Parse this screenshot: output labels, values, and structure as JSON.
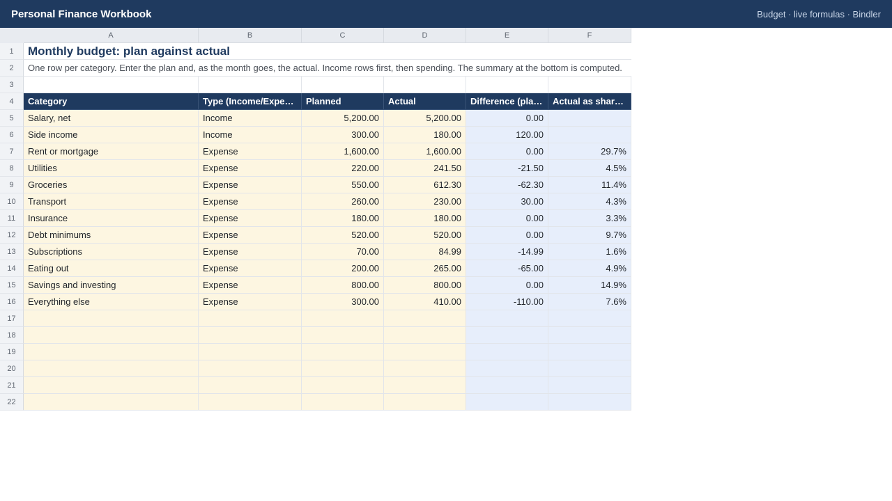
{
  "app": {
    "title": "Personal Finance Workbook",
    "meta": "Budget · live formulas · Bindler"
  },
  "colors": {
    "header_bar": "#1f3a5f",
    "input_cell": "#fdf6e1",
    "computed_cell": "#e7eefb"
  },
  "sheet": {
    "columns": [
      "A",
      "B",
      "C",
      "D",
      "E",
      "F"
    ],
    "title": "Monthly budget: plan against actual",
    "description": "One row per category. Enter the plan and, as the month goes, the actual. Income rows first, then spending. The summary at the bottom is computed.",
    "headers": [
      "Category",
      "Type (Income/Expen…",
      "Planned",
      "Actual",
      "Difference (plan…",
      "Actual as share…"
    ],
    "rows": [
      [
        "Salary, net",
        "Income",
        "5,200.00",
        "5,200.00",
        "0.00",
        ""
      ],
      [
        "Side income",
        "Income",
        "300.00",
        "180.00",
        "120.00",
        ""
      ],
      [
        "Rent or mortgage",
        "Expense",
        "1,600.00",
        "1,600.00",
        "0.00",
        "29.7%"
      ],
      [
        "Utilities",
        "Expense",
        "220.00",
        "241.50",
        "-21.50",
        "4.5%"
      ],
      [
        "Groceries",
        "Expense",
        "550.00",
        "612.30",
        "-62.30",
        "11.4%"
      ],
      [
        "Transport",
        "Expense",
        "260.00",
        "230.00",
        "30.00",
        "4.3%"
      ],
      [
        "Insurance",
        "Expense",
        "180.00",
        "180.00",
        "0.00",
        "3.3%"
      ],
      [
        "Debt minimums",
        "Expense",
        "520.00",
        "520.00",
        "0.00",
        "9.7%"
      ],
      [
        "Subscriptions",
        "Expense",
        "70.00",
        "84.99",
        "-14.99",
        "1.6%"
      ],
      [
        "Eating out",
        "Expense",
        "200.00",
        "265.00",
        "-65.00",
        "4.9%"
      ],
      [
        "Savings and investing",
        "Expense",
        "800.00",
        "800.00",
        "0.00",
        "14.9%"
      ],
      [
        "Everything else",
        "Expense",
        "300.00",
        "410.00",
        "-110.00",
        "7.6%"
      ]
    ],
    "row_numbers": [
      "1",
      "2",
      "3",
      "4",
      "5",
      "6",
      "7",
      "8",
      "9",
      "10",
      "11",
      "12",
      "13",
      "14",
      "15",
      "16",
      "17",
      "18",
      "19",
      "20",
      "21",
      "22"
    ]
  }
}
